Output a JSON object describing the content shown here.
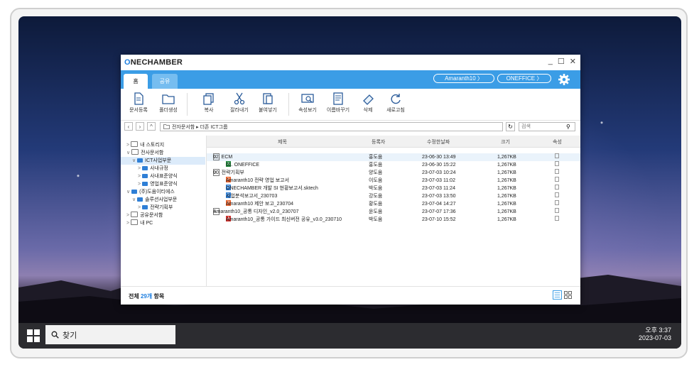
{
  "app": {
    "logo_prefix": "O",
    "logo_rest": "NECHAMBER",
    "tabs": [
      "홈",
      "공유"
    ],
    "pills": [
      "Amaranth10 〉",
      "ONEFFICE 〉"
    ],
    "window_controls": [
      "_",
      "☐",
      "✕"
    ]
  },
  "toolbar": {
    "items": [
      "문서등록",
      "폴더생성",
      "복사",
      "잘라내기",
      "붙여넣기",
      "속성보기",
      "이름바꾸기",
      "삭제",
      "새로고침"
    ]
  },
  "address": {
    "path": "전자문서함 ▸ 더존 ICT그룹",
    "search_placeholder": "검색"
  },
  "tree": [
    {
      "label": "내 스토리지",
      "chev": ">"
    },
    {
      "label": "전사문서함",
      "chev": "∨"
    },
    {
      "label": "ICT사업부문",
      "chev": "∨"
    },
    {
      "label": "사내규정",
      "chev": ">"
    },
    {
      "label": "사내표준양식",
      "chev": ">"
    },
    {
      "label": "영업표준양식",
      "chev": ">"
    },
    {
      "label": "(주)도움이티에스",
      "chev": "∨"
    },
    {
      "label": "솔루션사업부문",
      "chev": "∨"
    },
    {
      "label": "전략기획부",
      "chev": ">"
    },
    {
      "label": "공유문서함",
      "chev": ">"
    },
    {
      "label": "내 PC",
      "chev": ">"
    }
  ],
  "columns": [
    "제목",
    "등록자",
    "수정한날짜",
    "크기",
    "속성"
  ],
  "rows": [
    {
      "title": "02. ECM",
      "owner": "홍도움",
      "date": "23-06-30 13:49",
      "size": "1,267KB",
      "chev": "∨"
    },
    {
      "title": "01. ONEFFICE",
      "owner": "홍도움",
      "date": "23-06-30 15:22",
      "size": "1,267KB",
      "chev": ""
    },
    {
      "title": "00. 전략기획부",
      "owner": "양도움",
      "date": "23-07-03 10:24",
      "size": "1,267KB",
      "chev": "∨"
    },
    {
      "title": "Amaranth10 전략 영업 보고서",
      "owner": "이도움",
      "date": "23-07-03 11:02",
      "size": "1,267KB",
      "chev": ""
    },
    {
      "title": "ONECHAMBER 개발 SI 현황보고서.sktech",
      "owner": "박도움",
      "date": "23-07-03 11:24",
      "size": "1,267KB",
      "chev": ""
    },
    {
      "title": "사업분석보고서_230703",
      "owner": "강도움",
      "date": "23-07-03 13:50",
      "size": "1,267KB",
      "chev": ""
    },
    {
      "title": "Amaranth10 제안 보고_230704",
      "owner": "황도움",
      "date": "23-07-04 14:27",
      "size": "1,267KB",
      "chev": ""
    },
    {
      "title": "Amaranth10_공통 디자인_v2.0_230707",
      "owner": "윤도움",
      "date": "23-07-07 17:36",
      "size": "1,267KB",
      "chev": "∨"
    },
    {
      "title": "Amaranth10_공통 가이드 최신버전 공유_v3.0_230710",
      "owner": "박도움",
      "date": "23-07-10 15:52",
      "size": "1,267KB",
      "chev": ""
    }
  ],
  "status": {
    "prefix": "전체",
    "count": "29개",
    "suffix": "항목"
  },
  "taskbar": {
    "search_label": "찾기",
    "time": "오후 3:37",
    "date": "2023-07-03"
  }
}
